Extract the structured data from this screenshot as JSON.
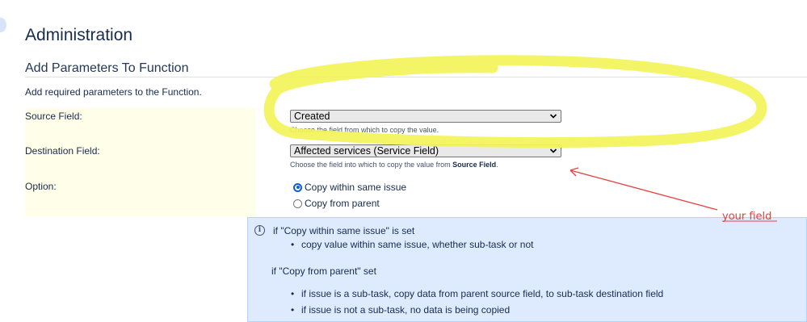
{
  "page": {
    "title": "Administration",
    "section_title": "Add Parameters To Function",
    "section_description": "Add required parameters to the Function."
  },
  "form": {
    "source_field": {
      "label": "Source Field:",
      "value": "Created",
      "hint": "Choose the field from which to copy the value."
    },
    "destination_field": {
      "label": "Destination Field:",
      "value": "Affected services (Service Field)",
      "hint_prefix": "Choose the field into which to copy the value from ",
      "hint_bold": "Source Field",
      "hint_suffix": "."
    },
    "option": {
      "label": "Option:",
      "choices": [
        {
          "label": "Copy within same issue",
          "checked": true
        },
        {
          "label": "Copy from parent",
          "checked": false
        }
      ]
    }
  },
  "info": {
    "line1": "if \"Copy within same issue\" is set",
    "bullet1": "copy value within same issue, whether sub-task or not",
    "line2": "if \"Copy from parent\" set",
    "bullet2": "if issue is a sub-task, copy data from parent source field, to sub-task destination field",
    "bullet3": "if issue is not a sub-task, no data is being copied"
  },
  "annotation": {
    "text": "your field",
    "highlight_color": "#f3f35a",
    "arrow_color": "#e8403d"
  }
}
